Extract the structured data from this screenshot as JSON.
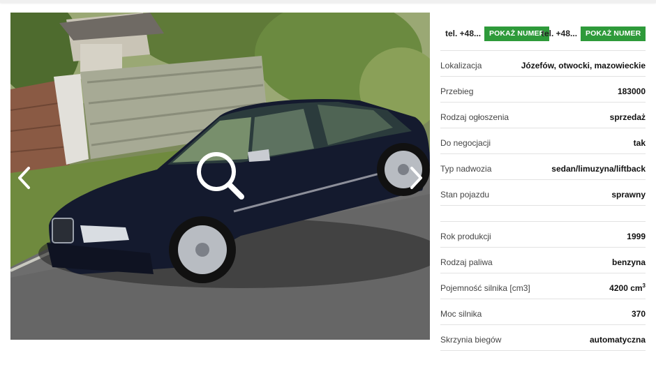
{
  "gallery": {
    "prev_icon": "chevron-left-icon",
    "next_icon": "chevron-right-icon",
    "zoom_icon": "magnifier-icon"
  },
  "contact": {
    "phones": [
      {
        "number": "tel. +48...",
        "button_label": "POKAŻ NUMER"
      },
      {
        "number": "tel. +48...",
        "button_label": "POKAŻ NUMER"
      }
    ],
    "button_color": "#2e9a3a"
  },
  "details": {
    "group1": [
      {
        "label": "Lokalizacja",
        "value": "Józefów, otwocki, mazowieckie"
      },
      {
        "label": "Przebieg",
        "value": "183000"
      },
      {
        "label": "Rodzaj ogłoszenia",
        "value": "sprzedaż"
      },
      {
        "label": "Do negocjacji",
        "value": "tak"
      },
      {
        "label": "Typ nadwozia",
        "value": "sedan/limuzyna/liftback"
      },
      {
        "label": "Stan pojazdu",
        "value": "sprawny"
      }
    ],
    "group2": [
      {
        "label": "Rok produkcji",
        "value": "1999"
      },
      {
        "label": "Rodzaj paliwa",
        "value": "benzyna"
      },
      {
        "label": "Pojemność silnika [cm3]",
        "value": "4200 cm",
        "unit_sup": "3"
      },
      {
        "label": "Moc silnika",
        "value": "370"
      },
      {
        "label": "Skrzynia biegów",
        "value": "automatyczna"
      }
    ]
  }
}
